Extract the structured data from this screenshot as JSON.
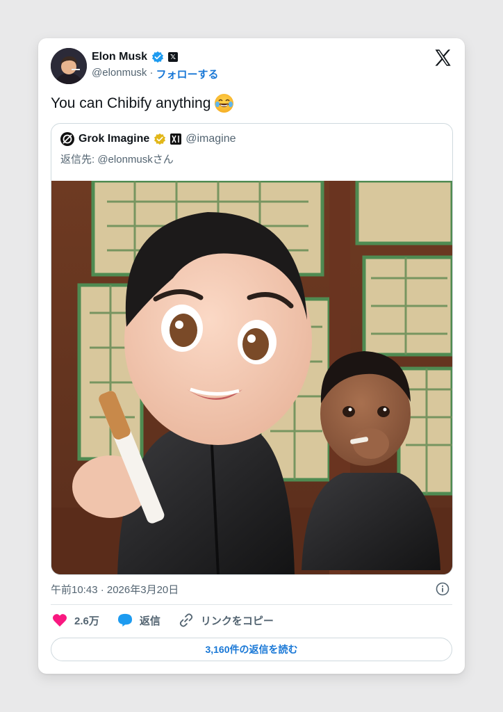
{
  "author": {
    "name": "Elon Musk",
    "handle": "@elonmusk",
    "separator": "·",
    "follow_label": "フォローする"
  },
  "tweet": {
    "text": "You can Chibify anything",
    "emoji": "face-with-tears-of-joy"
  },
  "quoted": {
    "name": "Grok Imagine",
    "handle": "@imagine",
    "reply_to": "返信先: @elonmuskさん"
  },
  "meta": {
    "timestamp": "午前10:43 · 2026年3月20日"
  },
  "actions": {
    "likes": "2.6万",
    "reply_label": "返信",
    "copy_link_label": "リンクをコピー",
    "read_replies_label": "3,160件の返信を読む"
  },
  "colors": {
    "verified_blue": "#1d9bf0",
    "verified_gold": "#e2b719",
    "like_pink": "#f91880",
    "link_blue": "#1877d6"
  }
}
